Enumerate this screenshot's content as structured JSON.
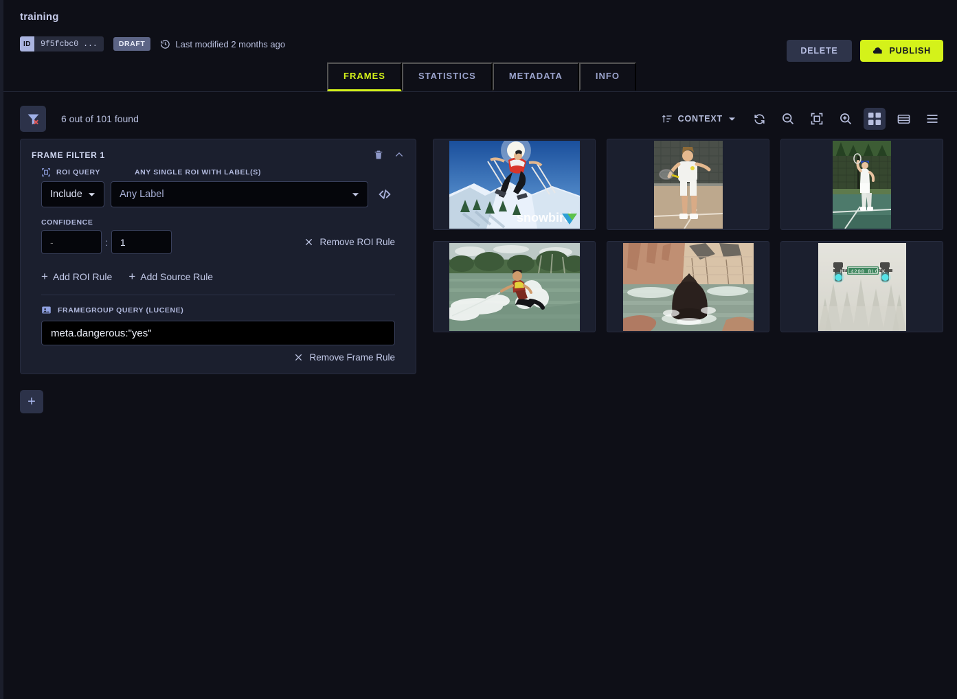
{
  "header": {
    "title": "training",
    "id_label": "ID",
    "id_value": "9f5fcbc0 ...",
    "status_badge": "DRAFT",
    "modified_text": "Last modified 2 months ago",
    "delete_label": "DELETE",
    "publish_label": "PUBLISH"
  },
  "tabs": [
    {
      "label": "FRAMES",
      "active": true
    },
    {
      "label": "STATISTICS",
      "active": false
    },
    {
      "label": "METADATA",
      "active": false
    },
    {
      "label": "INFO",
      "active": false
    }
  ],
  "toolbar": {
    "found_text": "6 out of 101 found",
    "sort_label": "CONTEXT",
    "icons": [
      "filter-clear-icon",
      "sort-icon",
      "chevron-down-icon",
      "refresh-icon",
      "zoom-out-icon",
      "fit-icon",
      "zoom-in-icon",
      "grid-view-icon",
      "list-view-icon",
      "menu-icon"
    ]
  },
  "filter": {
    "card_title": "FRAME FILTER 1",
    "roi_query_label": "ROI QUERY",
    "label_field_label": "ANY SINGLE ROI WITH LABEL(S)",
    "include_value": "Include",
    "label_value": "Any Label",
    "confidence_label": "CONFIDENCE",
    "confidence_min": "-",
    "confidence_min_placeholder": "-",
    "confidence_max": "1",
    "remove_roi_label": "Remove ROI Rule",
    "add_roi_label": "Add ROI Rule",
    "add_source_label": "Add Source Rule",
    "framegroup_label": "FRAMEGROUP QUERY (LUCENE)",
    "lucene_query": "meta.dangerous:\"yes\"",
    "remove_frame_label": "Remove Frame Rule",
    "add_filter_label": "+"
  },
  "thumbnails": [
    {
      "name": "skier-jumping-snowbird",
      "caption": "snowbird",
      "orientation": "landscape"
    },
    {
      "name": "tennis-player-forehand",
      "caption": "",
      "orientation": "portrait"
    },
    {
      "name": "tennis-player-serving",
      "caption": "",
      "orientation": "portrait"
    },
    {
      "name": "wakeboarder-on-lake",
      "caption": "",
      "orientation": "landscape"
    },
    {
      "name": "bear-sitting-in-water",
      "caption": "",
      "orientation": "landscape"
    },
    {
      "name": "traffic-light-in-fog",
      "caption": "NE 4200 BLOCK",
      "orientation": "square"
    }
  ],
  "colors": {
    "accent": "#d4f21a",
    "page_bg": "#0e0f17",
    "panel_bg": "#1b1f2e",
    "text": "#b9c0df"
  }
}
